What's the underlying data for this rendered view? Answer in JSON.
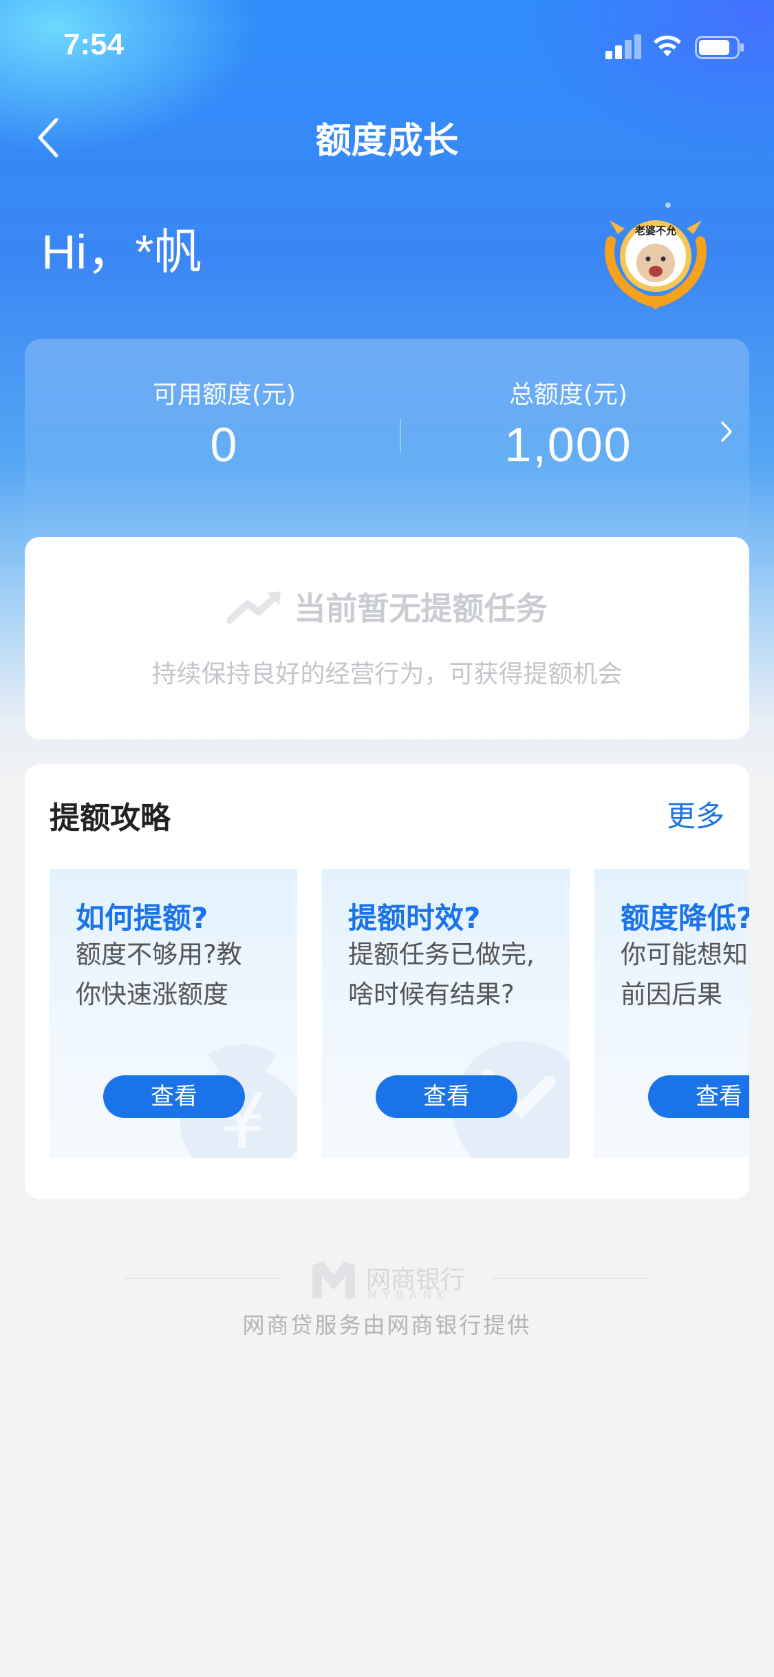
{
  "status_bar": {
    "time": "7:54"
  },
  "nav": {
    "title": "额度成长"
  },
  "greeting": "Hi，*帆",
  "badge": {
    "text": "老婆不允"
  },
  "quota": {
    "available_label": "可用额度(元)",
    "available_value": "0",
    "total_label": "总额度(元)",
    "total_value": "1,000"
  },
  "empty_state": {
    "title": "当前暂无提额任务",
    "subtitle": "持续保持良好的经营行为，可获得提额机会"
  },
  "strategy": {
    "title": "提额攻略",
    "more": "更多",
    "tiles": [
      {
        "title": "如何提额?",
        "line1": "额度不够用?教",
        "line2": "你快速涨额度",
        "button": "查看",
        "icon": "money-bag-icon"
      },
      {
        "title": "提额时效?",
        "line1": "提额任务已做完,",
        "line2": "啥时候有结果?",
        "button": "查看",
        "icon": "clock-icon"
      },
      {
        "title": "额度降低?",
        "line1": "你可能想知道",
        "line2": "前因后果",
        "button": "查看",
        "icon": "circle-icon"
      }
    ]
  },
  "footer": {
    "logo_cn": "网商银行",
    "logo_en": "MYBANK",
    "text": "网商贷服务由网商银行提供"
  },
  "colors": {
    "accent": "#1a73e8",
    "hero": "#3b86f5"
  }
}
